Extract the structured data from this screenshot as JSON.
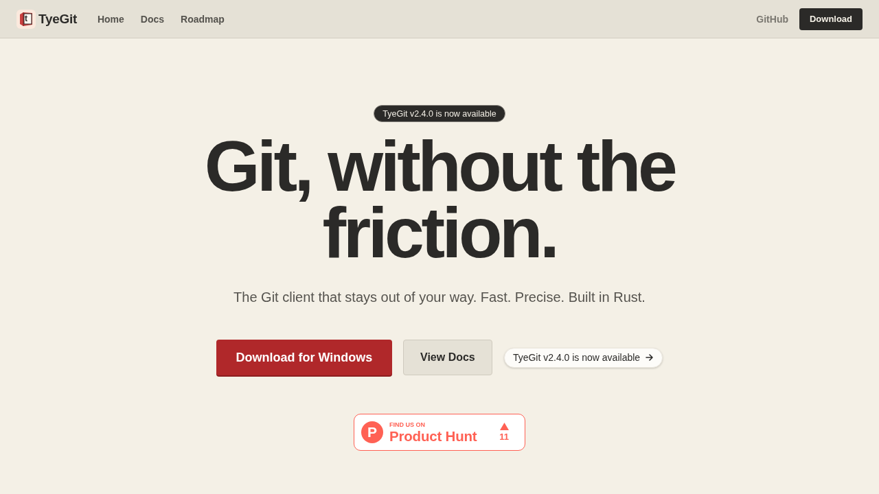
{
  "nav": {
    "brand": {
      "name": "TyeGit",
      "logo_letter": "t"
    },
    "links": [
      {
        "label": "Home"
      },
      {
        "label": "Docs"
      },
      {
        "label": "Roadmap"
      }
    ],
    "github": "GitHub",
    "download": "Download"
  },
  "hero": {
    "announcement": "TyeGit v2.4.0 is now available",
    "headline": "Git, without the friction.",
    "subtitle": "The Git client that stays out of your way. Fast. Precise. Built in Rust.",
    "actions": [
      {
        "kind": "primary",
        "label": "Download for Windows"
      },
      {
        "kind": "secondary",
        "label": "View Docs"
      },
      {
        "kind": "release",
        "label": "TyeGit v2.4.0 is now available"
      }
    ]
  },
  "product_hunt": {
    "logo_letter": "P",
    "kicker": "FIND US ON",
    "name": "Product Hunt",
    "upvotes": "11"
  }
}
